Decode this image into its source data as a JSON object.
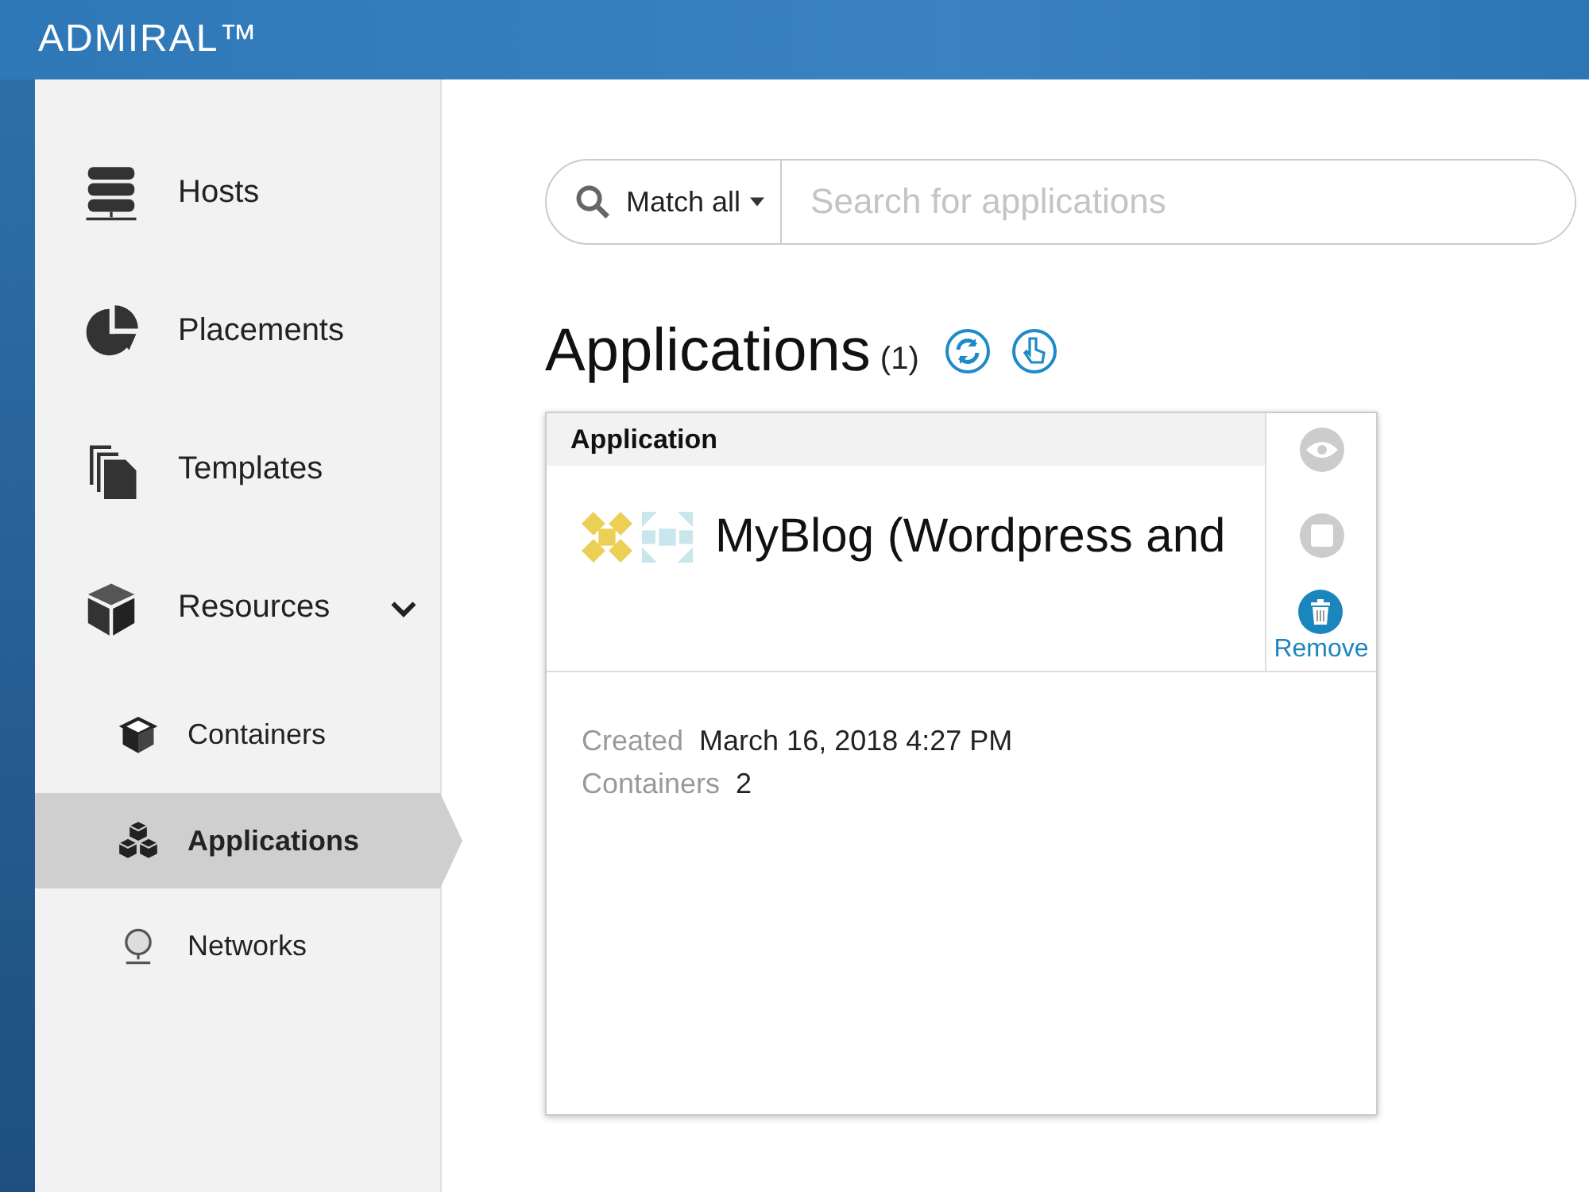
{
  "header": {
    "brand": "ADMIRAL™"
  },
  "sidebar": {
    "items": [
      {
        "label": "Hosts",
        "selected": false
      },
      {
        "label": "Placements",
        "selected": false
      },
      {
        "label": "Templates",
        "selected": false
      },
      {
        "label": "Resources",
        "selected": false,
        "expanded": true,
        "children": [
          {
            "label": "Containers",
            "selected": false
          },
          {
            "label": "Applications",
            "selected": true
          },
          {
            "label": "Networks",
            "selected": false
          }
        ]
      }
    ]
  },
  "search": {
    "filter": "Match all",
    "placeholder": "Search for applications"
  },
  "page": {
    "title": "Applications",
    "count": "(1)"
  },
  "cards": [
    {
      "type": "Application",
      "name": "MyBlog (Wordpress and",
      "action": "Remove",
      "fields": [
        {
          "label": "Created",
          "value": "March 16, 2018 4:27 PM"
        },
        {
          "label": "Containers",
          "value": "2"
        }
      ]
    }
  ]
}
